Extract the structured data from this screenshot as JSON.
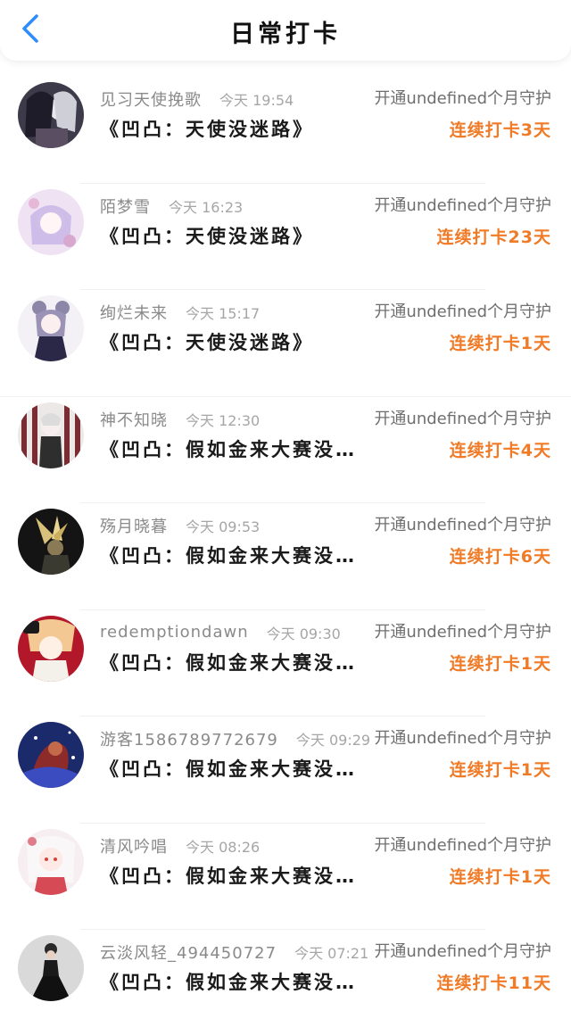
{
  "header": {
    "title": "日常打卡",
    "back_icon": "chevron-left-icon",
    "accent": "#2f8cff"
  },
  "colors": {
    "streak": "#f07a26",
    "muted": "#8a8a8a"
  },
  "items": [
    {
      "username": "见习天使挽歌",
      "time": "今天 19:54",
      "membership": "开通undefined个月守护",
      "title": "《凹凸：天使没迷路》",
      "streak": "连续打卡3天",
      "avatar_icon": "avatar-anime-dark-hair"
    },
    {
      "username": "陌梦雪",
      "time": "今天 16:23",
      "membership": "开通undefined个月守护",
      "title": "《凹凸：天使没迷路》",
      "streak": "连续打卡23天",
      "avatar_icon": "avatar-anime-pink"
    },
    {
      "username": "绚烂未来",
      "time": "今天 15:17",
      "membership": "开通undefined个月守护",
      "title": "《凹凸：天使没迷路》",
      "streak": "连续打卡1天",
      "avatar_icon": "avatar-anime-buns"
    },
    {
      "username": "神不知晓",
      "time": "今天 12:30",
      "membership": "开通undefined个月守护",
      "title": "《凹凸：假如金来大赛没…",
      "streak": "连续打卡4天",
      "avatar_icon": "avatar-anime-stripes"
    },
    {
      "username": "殇月晓暮",
      "time": "今天 09:53",
      "membership": "开通undefined个月守护",
      "title": "《凹凸：假如金来大赛没…",
      "streak": "连续打卡6天",
      "avatar_icon": "avatar-dark-gold"
    },
    {
      "username": "redemptiondawn",
      "time": "今天 09:30",
      "membership": "开通undefined个月守护",
      "title": "《凹凸：假如金来大赛没…",
      "streak": "连续打卡1天",
      "avatar_icon": "avatar-anime-red"
    },
    {
      "username": "游客1586789772679",
      "time": "今天 09:29",
      "membership": "开通undefined个月守护",
      "title": "《凹凸：假如金来大赛没…",
      "streak": "连续打卡1天",
      "avatar_icon": "avatar-galaxy"
    },
    {
      "username": "清风吟唱",
      "time": "今天 08:26",
      "membership": "开通undefined个月守护",
      "title": "《凹凸：假如金来大赛没…",
      "streak": "连续打卡1天",
      "avatar_icon": "avatar-anime-white"
    },
    {
      "username": "云淡风轻_494450727",
      "time": "今天 07:21",
      "membership": "开通undefined个月守护",
      "title": "《凹凸：假如金来大赛没…",
      "streak": "连续打卡11天",
      "avatar_icon": "avatar-photo-dress"
    }
  ]
}
